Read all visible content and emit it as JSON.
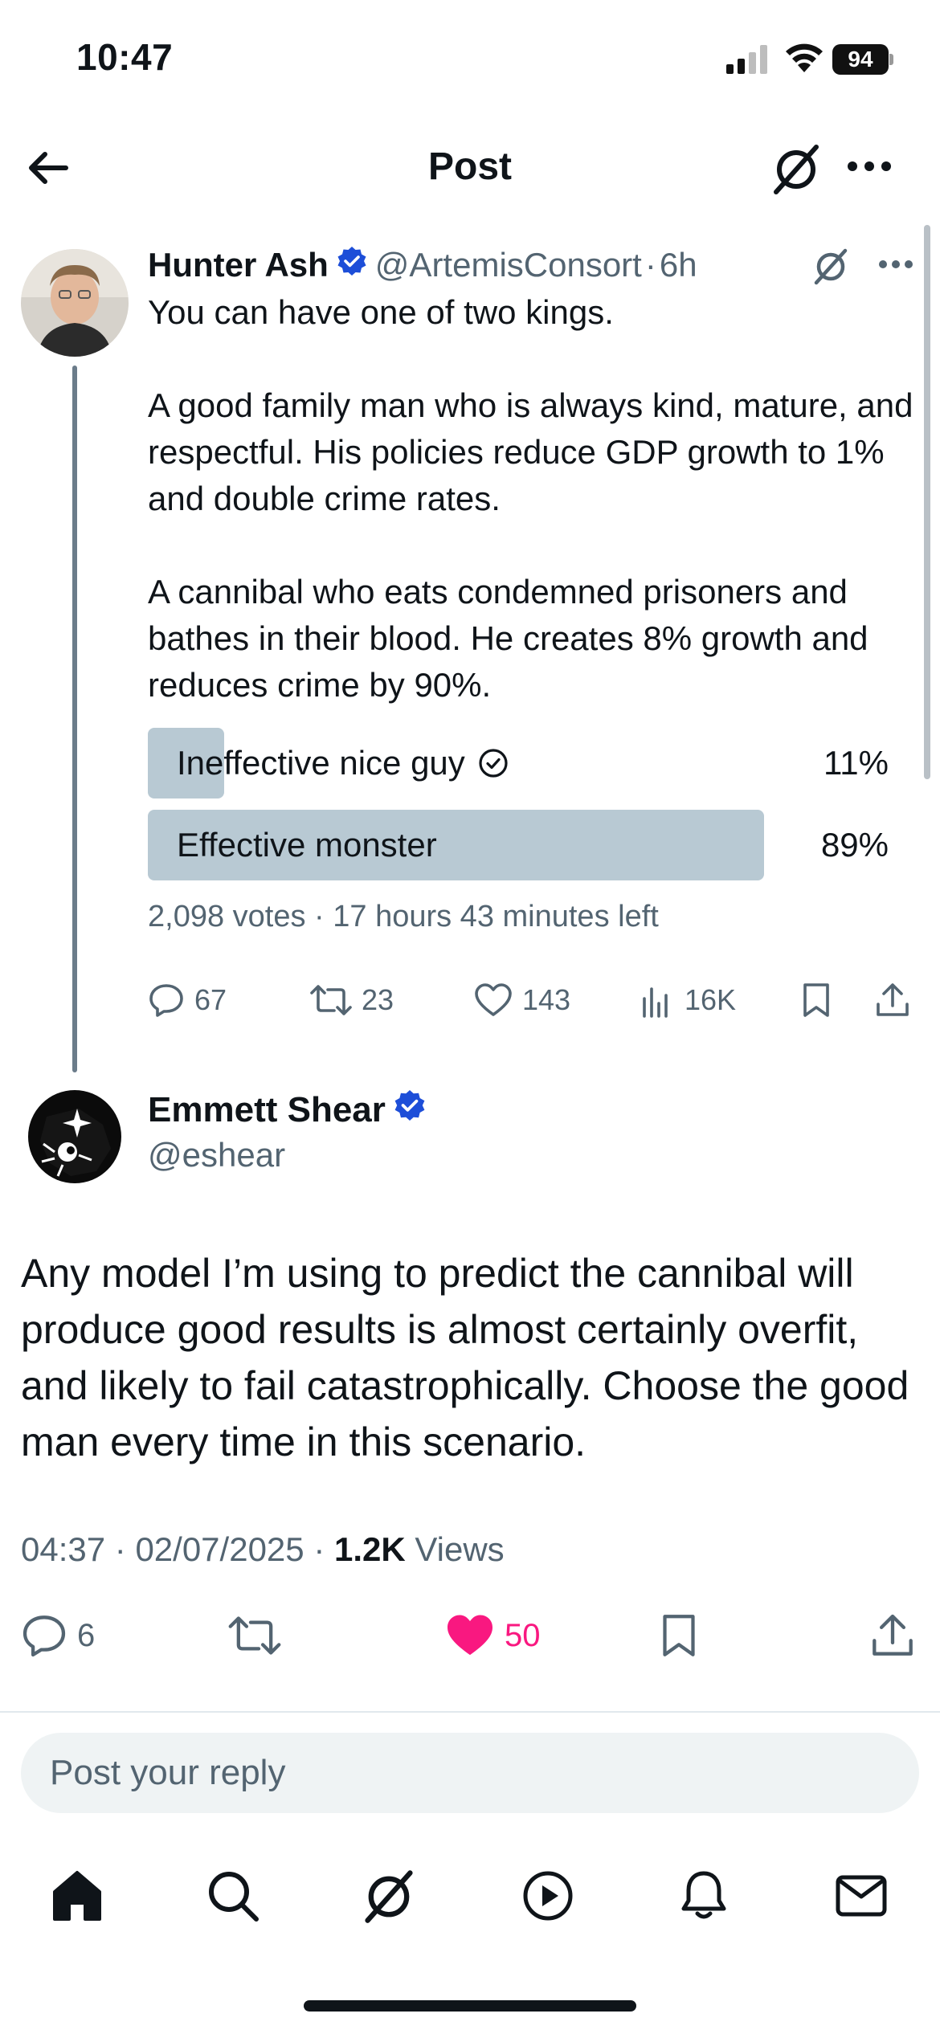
{
  "status_bar": {
    "time": "10:47",
    "battery": "94"
  },
  "header": {
    "title": "Post"
  },
  "parent_post": {
    "author_name": "Hunter Ash",
    "handle": "@ArtemisConsort",
    "separator": "·",
    "age": "6h",
    "text_lines": [
      "You can have one of two kings.",
      "A good family man who is always kind, mature, and respectful. His policies reduce GDP growth to 1% and double crime rates.",
      "A cannibal who eats condemned prisoners and bathes in their blood. He creates 8% growth and reduces crime by 90%."
    ],
    "poll": {
      "options": [
        {
          "label": "Ineffective nice guy",
          "percent_text": "11%",
          "percent": 11,
          "selected": true
        },
        {
          "label": "Effective monster",
          "percent_text": "89%",
          "percent": 89,
          "selected": false
        }
      ],
      "meta": "2,098 votes · 17 hours 43 minutes left"
    },
    "actions": {
      "replies": "67",
      "reposts": "23",
      "likes": "143",
      "views": "16K"
    }
  },
  "main_post": {
    "author_name": "Emmett Shear",
    "handle": "@eshear",
    "text": "Any model I’m using to predict the cannibal will produce good results is almost certainly overfit, and likely to fail catastrophically. Choose the good man every time in this scenario.",
    "time": "04:37",
    "date": "02/07/2025",
    "views_count": "1.2K",
    "views_label": "Views",
    "actions": {
      "replies": "6",
      "likes": "50"
    }
  },
  "reply": {
    "placeholder": "Post your reply"
  },
  "tabbar": {
    "items": [
      "home-icon",
      "search-icon",
      "grok-icon",
      "video-icon",
      "notifications-icon",
      "messages-icon"
    ]
  },
  "colors": {
    "like": "#f91880",
    "verified": "#1d4ed8",
    "poll_fill": "#b8c9d3",
    "secondary_text": "#536471"
  }
}
